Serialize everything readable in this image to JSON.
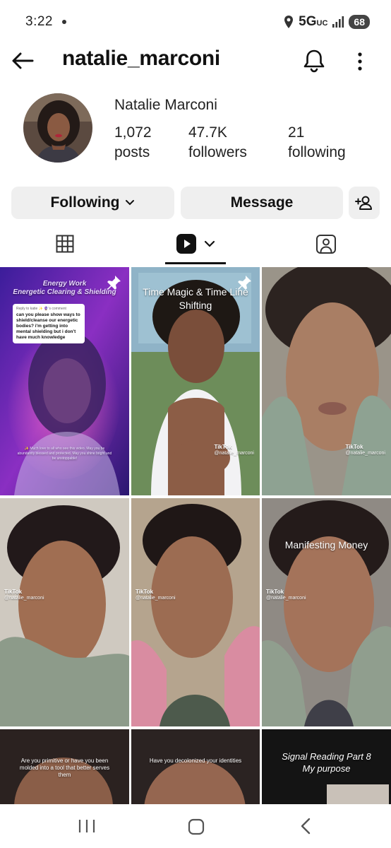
{
  "status_bar": {
    "time": "3:22",
    "network": "5G",
    "network_sub": "UC",
    "battery": "68"
  },
  "header": {
    "username": "natalie_marconi",
    "back_icon": "arrow-left-icon",
    "bell_icon": "bell-icon",
    "more_icon": "more-vertical-icon"
  },
  "profile": {
    "display_name": "Natalie Marconi",
    "stats": [
      {
        "value": "1,072",
        "label": "posts"
      },
      {
        "value": "47.7K",
        "label": "followers"
      },
      {
        "value": "21",
        "label": "following"
      }
    ]
  },
  "actions": {
    "following_label": "Following",
    "message_label": "Message",
    "add_friend_icon": "add-person-icon"
  },
  "tabs": [
    {
      "name": "grid",
      "icon": "grid-icon"
    },
    {
      "name": "reels",
      "icon": "reels-play-icon",
      "active": true
    },
    {
      "name": "tagged",
      "icon": "tagged-person-icon"
    }
  ],
  "posts": [
    {
      "title": "Energy Work\nEnergetic Clearing & Shielding",
      "reply_to": "Reply to katie ✨ 🔮's comment",
      "comment": "can you please show ways to shield/cleanse our energetic bodies? i'm getting into mental shielding but i don't have much knowledge",
      "caption": "✨ Much love to all who see this video. May you be abundantly blessed and protected. May you shine bright and be unstoppable!",
      "pinned": true
    },
    {
      "title": "Time Magic & Time Line Shifting",
      "pinned": true,
      "tiktok": "TikTok",
      "handle": "@natalie_marconi"
    },
    {
      "title": "",
      "tiktok": "TikTok",
      "handle": "@natalie_marconi"
    },
    {
      "title": "",
      "tiktok": "TikTok",
      "handle": "@natalie_marconi"
    },
    {
      "title": "",
      "tiktok": "TikTok",
      "handle": "@natalie_marconi"
    },
    {
      "title": "Manifesting Money",
      "tiktok": "TikTok",
      "handle": "@natalie_marconi"
    },
    {
      "title": "Are you primitive or have you been molded into a tool that better serves them"
    },
    {
      "title": "Have you decolonized your identities"
    },
    {
      "title": "Signal Reading Part 8\nMy purpose"
    }
  ],
  "colors": {
    "button_bg": "#efefef",
    "text": "#111111"
  }
}
